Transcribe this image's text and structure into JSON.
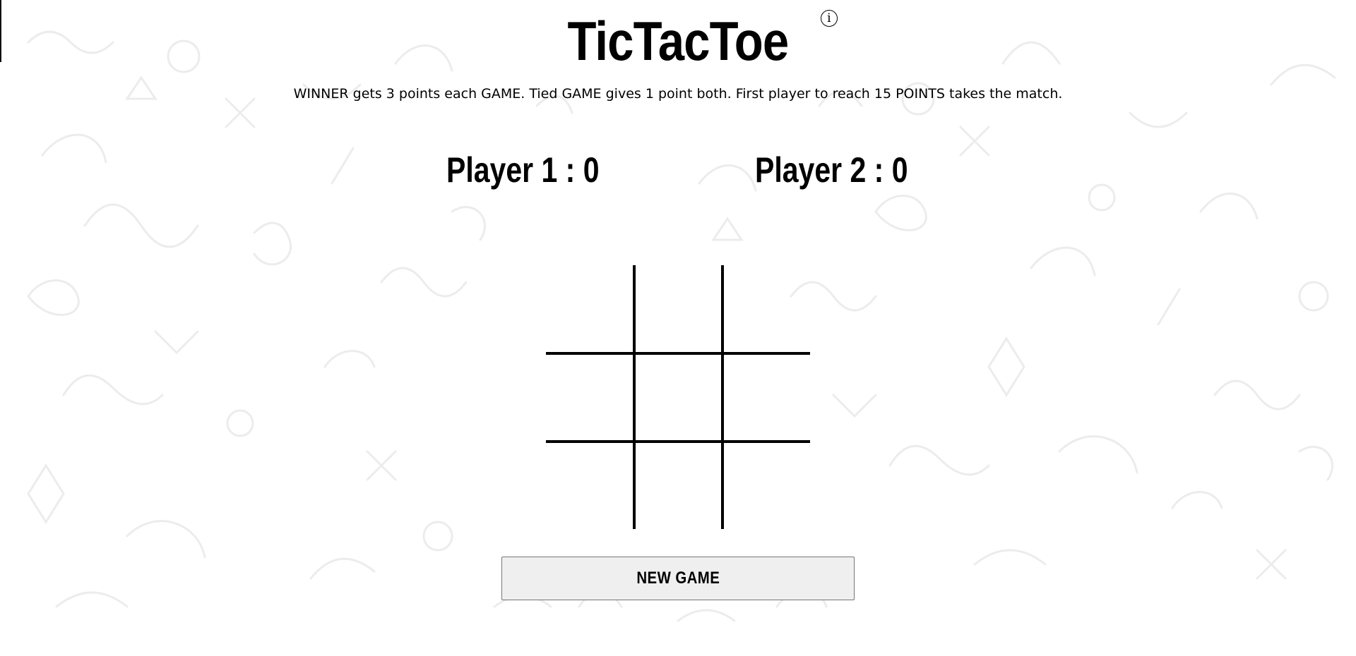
{
  "app": {
    "title": "TicTacToe",
    "info_icon": "info-icon",
    "rules": "WINNER gets 3 points each GAME. Tied GAME gives 1 point both. First player to reach 15 POINTS takes the match."
  },
  "scores": {
    "player1": "Player 1 : 0",
    "player2": "Player 2 : 0"
  },
  "board": {
    "cells": [
      "",
      "",
      "",
      "",
      "",
      "",
      "",
      "",
      ""
    ]
  },
  "controls": {
    "new_game_label": "NEW GAME"
  },
  "colors": {
    "background": "#ffffff",
    "doodle": "#ececec",
    "grid": "#000000",
    "button_bg": "#efefef"
  }
}
